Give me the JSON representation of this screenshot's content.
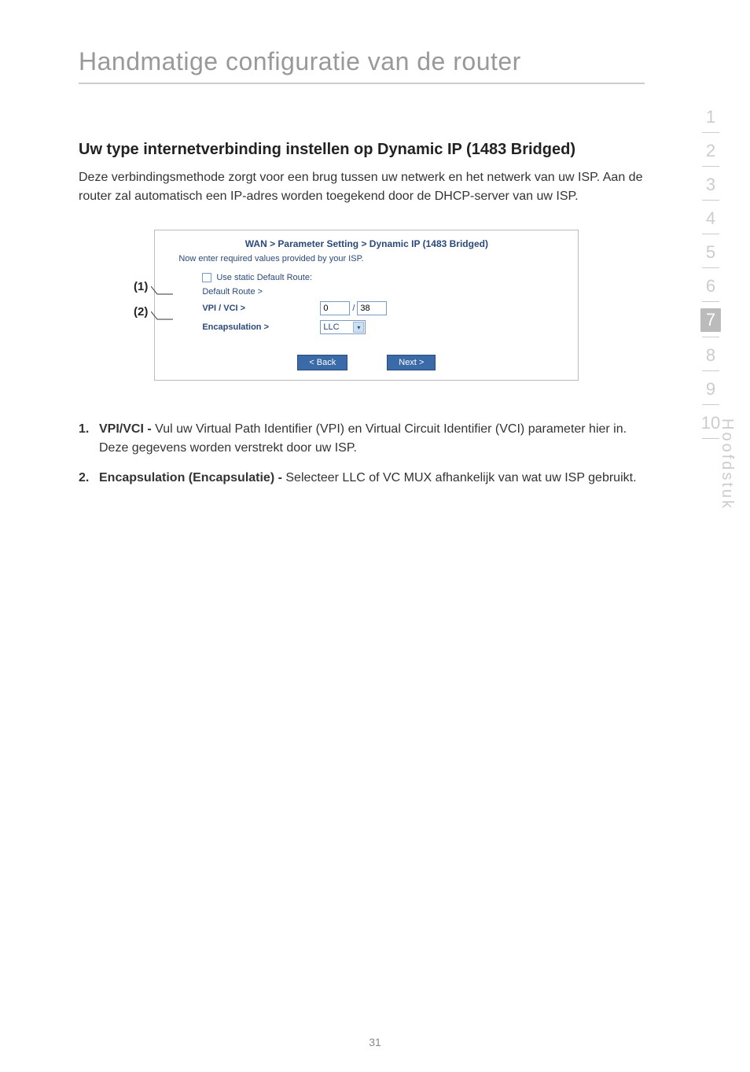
{
  "chapter_title": "Handmatige configuratie van de router",
  "section_heading": "Uw type internetverbinding instellen op Dynamic IP (1483 Bridged)",
  "intro_paragraph": "Deze verbindingsmethode zorgt voor een brug tussen uw netwerk en het netwerk van uw ISP. Aan de router zal automatisch een IP-adres worden toegekend door de DHCP-server van uw ISP.",
  "callouts": {
    "n1": "(1)",
    "n2": "(2)"
  },
  "panel": {
    "breadcrumb": "WAN > Parameter Setting > Dynamic IP (1483 Bridged)",
    "subtext": "Now enter required values provided by your ISP.",
    "use_static_label": "Use static Default Route:",
    "default_route_label": "Default Route >",
    "vpi_vci_label": "VPI / VCI >",
    "vpi_value": "0",
    "vci_value": "38",
    "encapsulation_label": "Encapsulation >",
    "encapsulation_value": "LLC",
    "back_btn": "< Back",
    "next_btn": "Next >"
  },
  "list": {
    "item1_num": "1.",
    "item1_lead": "VPI/VCI - ",
    "item1_body": "Vul uw Virtual Path Identifier (VPI) en Virtual Circuit Identifier (VCI) parameter hier in. Deze gegevens worden verstrekt door uw ISP.",
    "item2_num": "2.",
    "item2_lead": "Encapsulation (Encapsulatie) - ",
    "item2_body": "Selecteer LLC of VC MUX afhankelijk van wat uw ISP gebruikt."
  },
  "side_nav": {
    "n1": "1",
    "n2": "2",
    "n3": "3",
    "n4": "4",
    "n5": "5",
    "n6": "6",
    "n7": "7",
    "n8": "8",
    "n9": "9",
    "n10": "10",
    "vert": "Hoofdstuk"
  },
  "page_number": "31"
}
